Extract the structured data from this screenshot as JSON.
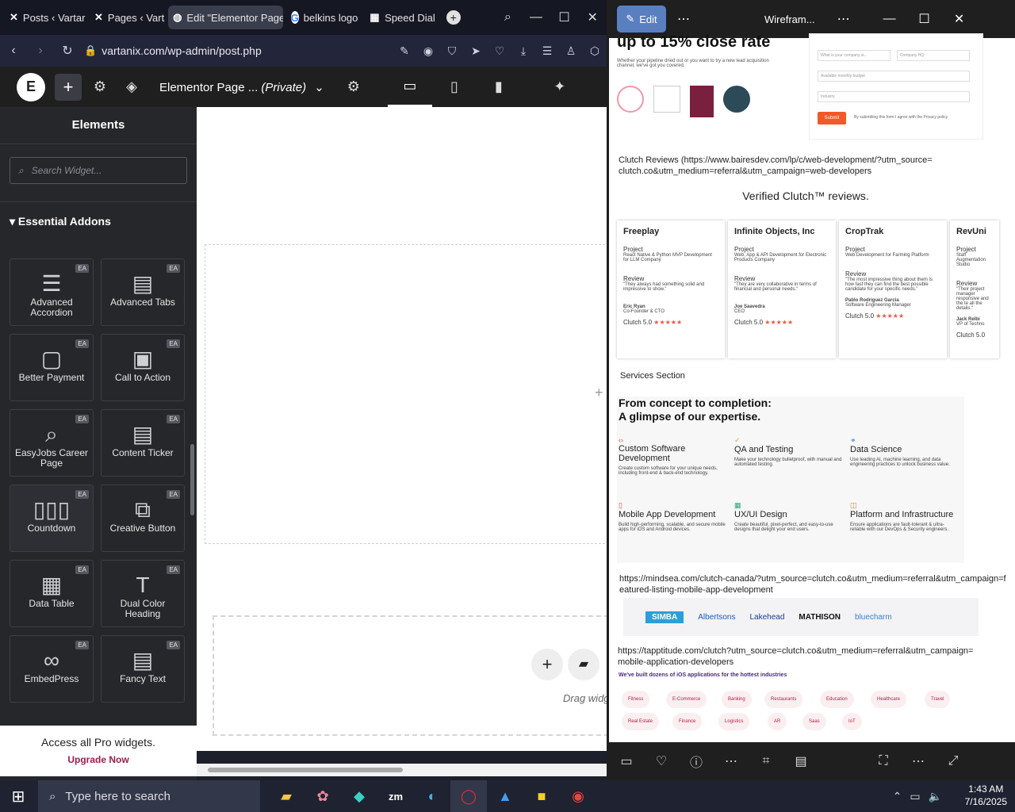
{
  "browser": {
    "tabs": [
      {
        "label": "Posts ‹ Vartar",
        "icon": "vartanix-icon"
      },
      {
        "label": "Pages ‹ Varta",
        "icon": "vartanix-icon"
      },
      {
        "label": "Edit \"Elementor Page",
        "icon": "globe-icon"
      },
      {
        "label": "belkins logo",
        "icon": "google-icon"
      },
      {
        "label": "Speed Dial",
        "icon": "grid-icon"
      }
    ],
    "url": "vartanix.com/wp-admin/post.php"
  },
  "elementor": {
    "page_title": "Elementor Page ...",
    "page_status": "(Private)",
    "panel_title": "Elements",
    "search_placeholder": "Search Widget...",
    "category": "Essential Addons",
    "widgets": [
      {
        "label": "Advanced Accordion",
        "badge": "EA"
      },
      {
        "label": "Advanced Tabs",
        "badge": "EA"
      },
      {
        "label": "Better Payment",
        "badge": "EA"
      },
      {
        "label": "Call to Action",
        "badge": "EA"
      },
      {
        "label": "EasyJobs Career Page",
        "badge": "EA"
      },
      {
        "label": "Content Ticker",
        "badge": "EA"
      },
      {
        "label": "Countdown",
        "badge": "EA"
      },
      {
        "label": "Creative Button",
        "badge": "EA"
      },
      {
        "label": "Data Table",
        "badge": "EA"
      },
      {
        "label": "Dual Color Heading",
        "badge": "EA"
      },
      {
        "label": "EmbedPress",
        "badge": "EA"
      },
      {
        "label": "Fancy Text",
        "badge": "EA"
      }
    ],
    "promo_text": "Access all Pro widgets.",
    "promo_link": "Upgrade Now",
    "drag_hint": "Drag widg"
  },
  "viewer": {
    "edit_label": "Edit",
    "title": "Wirefram...",
    "content": {
      "headline": "up to 15% close rate",
      "intro": "Whether your pipeline dried out or you want to try a new lead acquisition channel, we've got you covered.",
      "submit": "Submit",
      "consent": "By submitting this form I agree with the Privacy policy",
      "form_fields": [
        "What is your company si...",
        "Company HQ",
        "Available monthly budget",
        "Industry"
      ],
      "clutch_link": "Clutch Reviews (https://www.bairesdev.com/lp/c/web-development/?utm_source=clutch.co&utm_medium=referral&utm_campaign=web-developers",
      "verified": "Verified Clutch™ reviews.",
      "cards": [
        {
          "company": "Freeplay",
          "project": "React Native & Python MVP Development for LLM Company",
          "review": "\"They always had something solid and impressive to show.\"",
          "person": "Eric Ryan",
          "role": "Co-Founder & CTO"
        },
        {
          "company": "Infinite Objects, Inc",
          "project": "Web, App & API Development for Electronic Products Company",
          "review": "\"They are very collaborative in terms of financial and personal needs.\"",
          "person": "Joe Saavedra",
          "role": "CEO"
        },
        {
          "company": "CropTrak",
          "project": "Web Development for Farming Platform",
          "review": "\"The most impressive thing about them is how fast they can find the best possible candidate for your specific needs.\"",
          "person": "Pablo Rodriguez Garcia",
          "role": "Software Engineering Manager"
        },
        {
          "company": "RevUni",
          "project": "Staff Augmentation Studio",
          "review": "\"Their project manager responsive and the te all the details.\"",
          "person": "Jack Relbi",
          "role": "VP of Techno"
        }
      ],
      "project_label": "Project",
      "review_label": "Review",
      "clutch_score": "Clutch  5.0",
      "stars": "★★★★★",
      "services_label": "Services Section",
      "services_title_1": "From concept to completion:",
      "services_title_2": "A glimpse of our expertise.",
      "services": [
        {
          "name": "Custom Software Development",
          "desc": "Create custom software for your unique needs, including front-end & back-end technology."
        },
        {
          "name": "QA and Testing",
          "desc": "Make your technology bulletproof, with manual and automated testing."
        },
        {
          "name": "Data Science",
          "desc": "Use leading AI, machine learning, and data engineering practices to unlock business value."
        },
        {
          "name": "Mobile App Development",
          "desc": "Build high-performing, scalable, and secure mobile apps for iOS and Android devices."
        },
        {
          "name": "UX/UI Design",
          "desc": "Create beautiful, pixel-perfect, and easy-to-use designs that delight your end users."
        },
        {
          "name": "Platform and Infrastructure",
          "desc": "Ensure applications are fault-tolerant & ultra-reliable with our DevOps & Security engineers."
        }
      ],
      "mindsea_link": "https://mindsea.com/clutch-canada/?utm_source=clutch.co&utm_medium=referral&utm_campaign=featured-listing-mobile-app-development",
      "logos": [
        "SIMBA",
        "Albertsons",
        "Lakehead",
        "MATHISON",
        "bluecharm"
      ],
      "tapptitude_link": "https://tapptitude.com/clutch?utm_source=clutch.co&utm_medium=referral&utm_campaign=mobile-application-developers",
      "ios_line": "We've built dozens of iOS applications for the hottest industries",
      "industries": [
        "Fitness",
        "E-Commerce",
        "Banking",
        "Restaurants",
        "Education",
        "Healthcare",
        "Travel",
        "Real Estate",
        "Finance",
        "Logistics",
        "AR",
        "Saas",
        "IoT"
      ]
    }
  },
  "taskbar": {
    "search_placeholder": "Type here to search",
    "time": "1:43 AM",
    "date": "7/16/2025"
  }
}
